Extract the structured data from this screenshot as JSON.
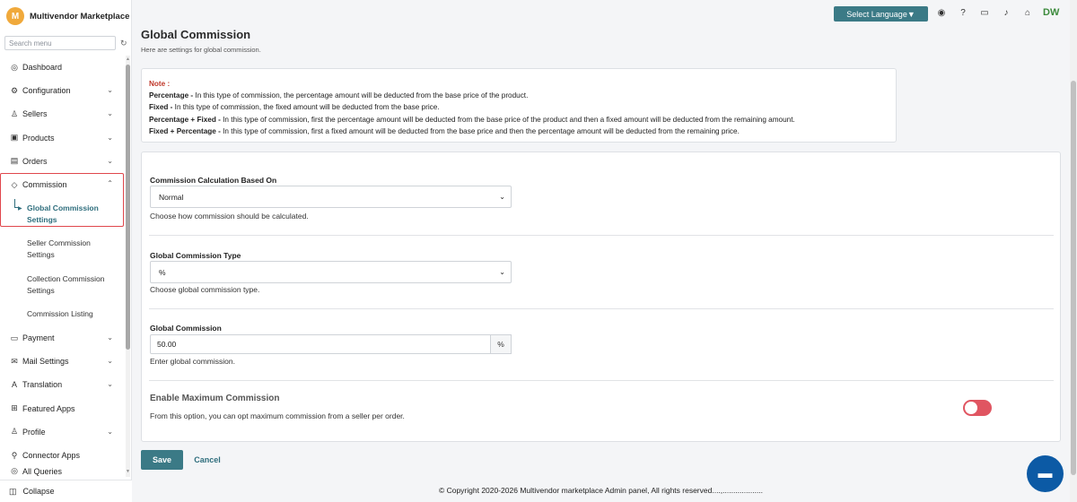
{
  "app": {
    "logo_letter": "M",
    "name": "Multivendor Marketplace"
  },
  "sidebar": {
    "search_placeholder": "Search menu",
    "items": [
      {
        "label": "Dashboard",
        "icon": "dashboard-icon",
        "glyph": "◎"
      },
      {
        "label": "Configuration",
        "icon": "settings-icon",
        "glyph": "⚙"
      },
      {
        "label": "Sellers",
        "icon": "person-icon",
        "glyph": "♙"
      },
      {
        "label": "Products",
        "icon": "box-icon",
        "glyph": "▣"
      },
      {
        "label": "Orders",
        "icon": "clipboard-icon",
        "glyph": "▤"
      },
      {
        "label": "Commission",
        "icon": "diamond-icon",
        "glyph": "◇"
      }
    ],
    "commission_sub": [
      "Global Commission Settings",
      "Seller Commission Settings",
      "Collection Commission Settings",
      "Commission Listing"
    ],
    "items_after": [
      {
        "label": "Payment",
        "icon": "payment-icon",
        "glyph": "▭"
      },
      {
        "label": "Mail Settings",
        "icon": "mail-icon",
        "glyph": "✉"
      },
      {
        "label": "Translation",
        "icon": "translate-icon",
        "glyph": "A"
      },
      {
        "label": "Featured Apps",
        "icon": "apps-icon",
        "glyph": "⊞"
      },
      {
        "label": "Profile",
        "icon": "profile-icon",
        "glyph": "♙"
      },
      {
        "label": "Connector Apps",
        "icon": "plug-icon",
        "glyph": "⚲"
      },
      {
        "label": "All Queries",
        "icon": "query-icon",
        "glyph": "◎"
      }
    ],
    "collapse_label": "Collapse"
  },
  "topbar": {
    "language_button": "Select Language▼",
    "user_initials": "DW"
  },
  "page": {
    "title": "Global Commission",
    "subtitle": "Here are settings for global commission."
  },
  "note": {
    "title": "Note :",
    "lines": [
      {
        "term": "Percentage -",
        "text": " In this type of commission, the percentage amount will be deducted from the base price of the product."
      },
      {
        "term": "Fixed -",
        "text": " In this type of commission, the fixed amount will be deducted from the base price."
      },
      {
        "term": "Percentage + Fixed -",
        "text": " In this type of commission, first the percentage amount will be deducted from the base price of the product and then a fixed amount will be deducted from the remaining amount."
      },
      {
        "term": "Fixed + Percentage -",
        "text": " In this type of commission, first a fixed amount will be deducted from the base price and then the percentage amount will be deducted from the remaining price."
      }
    ]
  },
  "form": {
    "calc_label": "Commission Calculation Based On",
    "calc_value": "Normal",
    "calc_help": "Choose how commission should be calculated.",
    "type_label": "Global Commission Type",
    "type_value": "%",
    "type_help": "Choose global commission type.",
    "commission_label": "Global Commission",
    "commission_value": "50.00",
    "commission_addon": "%",
    "commission_help": "Enter global commission.",
    "max_title": "Enable Maximum Commission",
    "max_help": "From this option, you can opt maximum commission from a seller per order.",
    "max_enabled": false
  },
  "actions": {
    "save": "Save",
    "cancel": "Cancel"
  },
  "footer": {
    "text": "© Copyright 2020-2026 Multivendor marketplace Admin panel, All rights reserved....,..................."
  },
  "colors": {
    "accent": "#3b7a86",
    "danger": "#e0474c",
    "note_title": "#c0392b",
    "chat": "#0c5aa5"
  }
}
